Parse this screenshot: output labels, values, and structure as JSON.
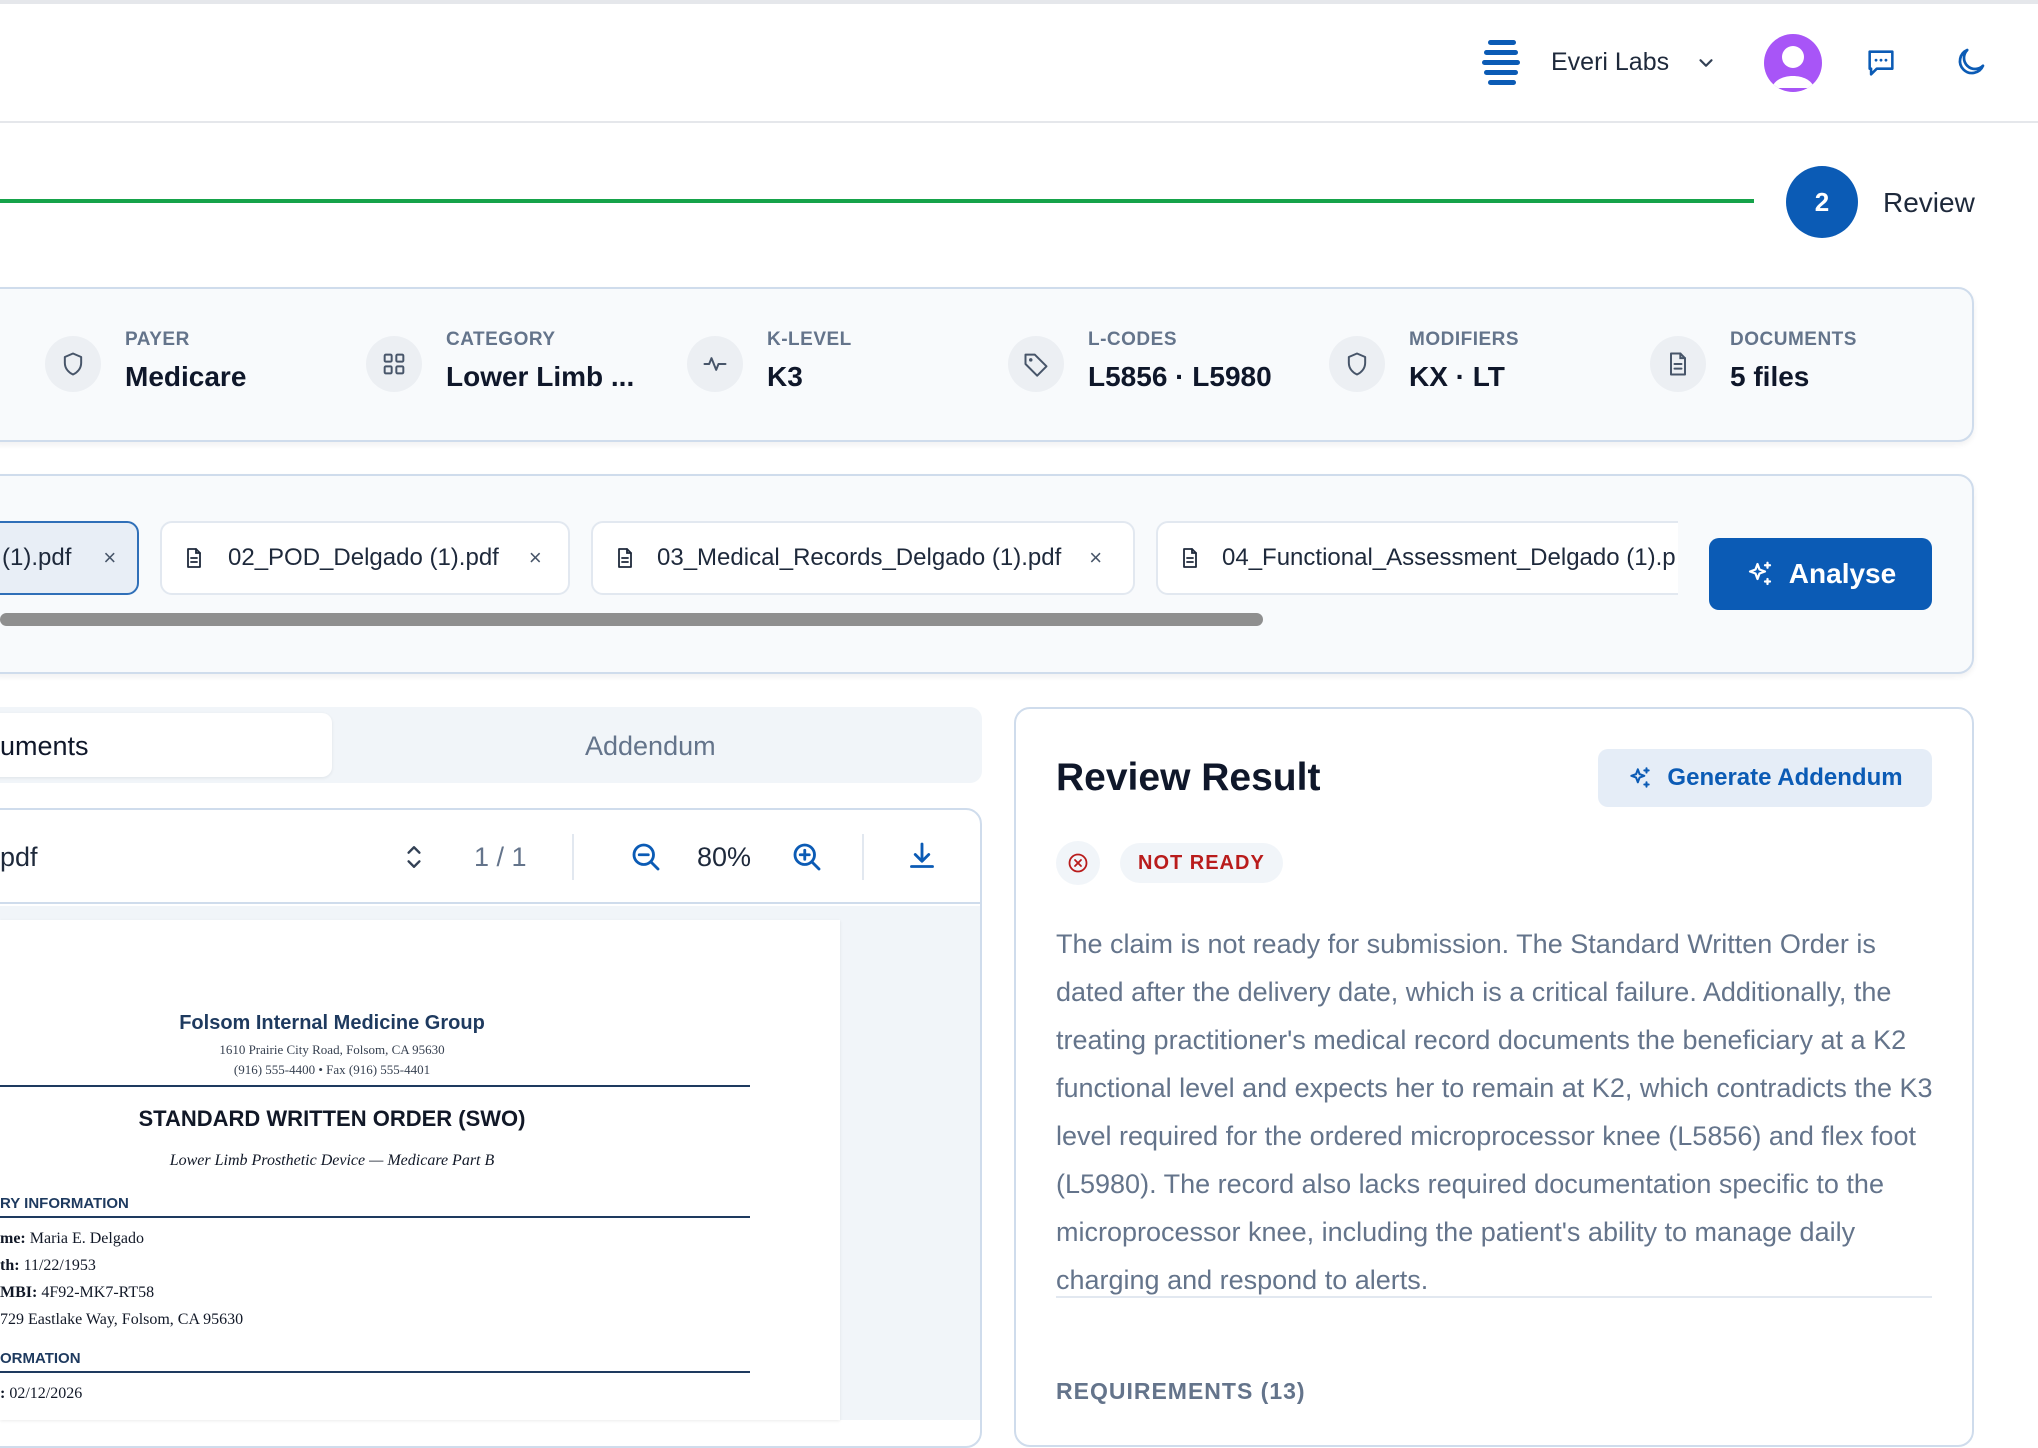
{
  "header": {
    "org_name": "Everi Labs",
    "org_icon": "stacked-bars-logo-icon",
    "avatar_icon": "user-avatar-icon",
    "chat_icon": "message-icon",
    "theme_icon": "moon-icon"
  },
  "stepper": {
    "current_step_number": "2",
    "current_step_label": "Review"
  },
  "summary": [
    {
      "icon": "shield-icon",
      "label": "PAYER",
      "value": "Medicare"
    },
    {
      "icon": "grid-icon",
      "label": "CATEGORY",
      "value": "Lower Limb ..."
    },
    {
      "icon": "activity-icon",
      "label": "K-LEVEL",
      "value": "K3"
    },
    {
      "icon": "tag-icon",
      "label": "L-CODES",
      "value": "L5856 · L5980"
    },
    {
      "icon": "shield-icon",
      "label": "MODIFIERS",
      "value": "KX · LT"
    },
    {
      "icon": "document-icon",
      "label": "DOCUMENTS",
      "value": "5 files"
    }
  ],
  "files": {
    "chips": [
      {
        "name": "(1).pdf",
        "active": true
      },
      {
        "name": "02_POD_Delgado (1).pdf",
        "active": false
      },
      {
        "name": "03_Medical_Records_Delgado (1).pdf",
        "active": false
      },
      {
        "name": "04_Functional_Assessment_Delgado (1).p",
        "active": false
      }
    ],
    "close_glyph": "×",
    "analyse_label": "Analyse"
  },
  "tabs": {
    "documents_label": "uments",
    "addendum_label": "Addendum"
  },
  "viewer": {
    "file_name": "pdf",
    "page_indicator": "1 / 1",
    "zoom": "80%"
  },
  "pdf": {
    "org": "Folsom Internal Medicine Group",
    "address": "1610 Prairie City Road, Folsom, CA 95630",
    "phone": "(916) 555-4400  •  Fax (916) 555-4401",
    "doc_title": "STANDARD WRITTEN ORDER (SWO)",
    "doc_subtitle": "Lower Limb Prosthetic Device — Medicare Part B",
    "section1": "RY INFORMATION",
    "fields": [
      {
        "label": "me:",
        "value": " Maria E. Delgado"
      },
      {
        "label": "th:",
        "value": " 11/22/1953"
      },
      {
        "label": "MBI:",
        "value": " 4F92-MK7-RT58"
      },
      {
        "label": "",
        "value": "729 Eastlake Way, Folsom, CA 95630"
      }
    ],
    "section2": "ORMATION",
    "field2": {
      "label": ":",
      "value": " 02/12/2026"
    }
  },
  "review": {
    "title": "Review Result",
    "generate_label": "Generate Addendum",
    "status": "NOT READY",
    "summary": "The claim is not ready for submission. The Standard Written Order is dated after the delivery date, which is a critical failure. Additionally, the treating practitioner's medical record documents the beneficiary at a K2 functional level and expects her to remain at K2, which contradicts the K3 level required for the ordered microprocessor knee (L5856) and flex foot (L5980). The record also lacks required documentation specific to the microprocessor knee, including the patient's ability to manage daily charging and respond to alerts.",
    "requirements_label": "REQUIREMENTS (13)"
  },
  "colors": {
    "primary": "#0b5bb5",
    "progress": "#16a34a",
    "status_red": "#b91c1c",
    "avatar": "#a855f7"
  }
}
